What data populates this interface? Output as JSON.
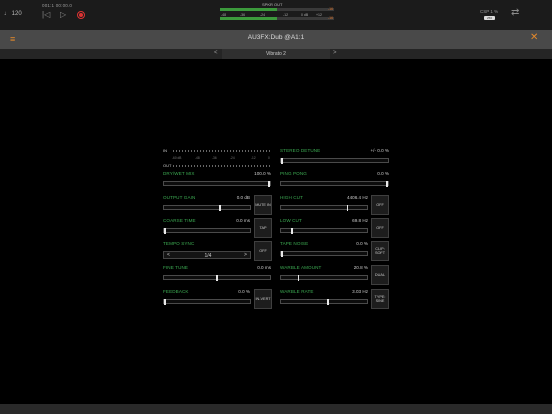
{
  "transport": {
    "tempo": "♩ 120",
    "time": "001:1  00:00.0"
  },
  "meter": {
    "label": "SPKR OUT",
    "scale": [
      "-48",
      "-36",
      "-24",
      "-12",
      "0 dB",
      "+12"
    ],
    "peak_l": "-16",
    "peak_r": "-16",
    "fill_fraction": 0.5
  },
  "cpu": {
    "label": "CSP  1 %",
    "buffer": "256"
  },
  "plugin": {
    "title": "AU3FX:Dub @A1:1",
    "preset": "Vibrato 2",
    "prev": "<",
    "next": ">"
  },
  "panel": {
    "in_label": "IN",
    "out_label": "OUT",
    "meter_scale": [
      "-60 dB",
      "-48",
      "-36",
      "-24",
      "-12",
      "0"
    ],
    "left": {
      "dry_wet_mix": {
        "label": "DRY/WET MIX",
        "value": "100.0 %",
        "level": 1.0
      },
      "output_gain": {
        "label": "OUTPUT GAIN",
        "value": "0.0 dB",
        "level": 0.66,
        "button": "MUTE IN"
      },
      "coarse_time": {
        "label": "COARSE TIME",
        "value": "0.0 ms",
        "level": 0.0,
        "button": "TAP"
      },
      "tempo_sync": {
        "label": "TEMPO SYNC",
        "value": "1/4",
        "button": "OFF"
      },
      "fine_tune": {
        "label": "FINE TUNE",
        "value": "0.0 ms",
        "level": 0.5
      },
      "feedback": {
        "label": "FEEDBACK",
        "value": "0.0 %",
        "level": 0.0,
        "button": "IN-VERT"
      }
    },
    "right": {
      "stereo_detune": {
        "label": "STEREO DETUNE",
        "value": "+/- 0.0 %",
        "level": 0.0
      },
      "ping_pong": {
        "label": "PING PONG",
        "value": "0.0 %",
        "level": 1.0
      },
      "high_cut": {
        "label": "HIGH CUT",
        "value": "4406.4 Hz",
        "level": 0.78,
        "button": "OFF"
      },
      "low_cut": {
        "label": "LOW CUT",
        "value": "69.8 Hz",
        "level": 0.12,
        "button": "OFF"
      },
      "tape_noise": {
        "label": "TAPE NOISE",
        "value": "0.0 %",
        "level": 0.0,
        "button": "CLIP: SOFT"
      },
      "warble_amount": {
        "label": "WARBLE AMOUNT",
        "value": "20.8 %",
        "level": 0.2,
        "button": "DUAL"
      },
      "warble_rate": {
        "label": "WARBLE RATE",
        "value": "3.03 Hz",
        "level": 0.55,
        "button": "TYPE: SINE"
      }
    }
  }
}
